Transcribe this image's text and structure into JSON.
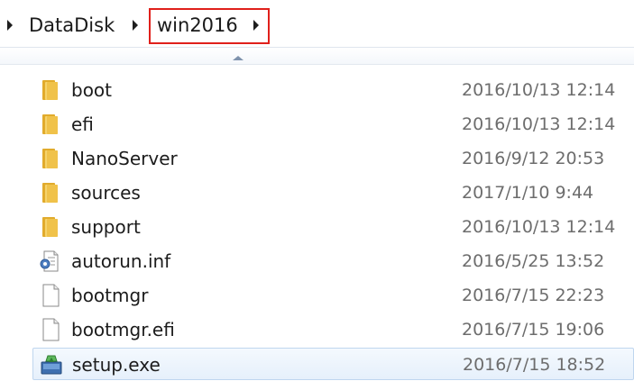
{
  "breadcrumb": {
    "segments": [
      {
        "label": "DataDisk"
      },
      {
        "label": "win2016"
      }
    ]
  },
  "file_list": {
    "sort_indicator": "ascending",
    "items": [
      {
        "name": "boot",
        "modified": "2016/10/13 12:14",
        "icon": "folder-icon"
      },
      {
        "name": "efi",
        "modified": "2016/10/13 12:14",
        "icon": "folder-icon"
      },
      {
        "name": "NanoServer",
        "modified": "2016/9/12 20:53",
        "icon": "folder-icon"
      },
      {
        "name": "sources",
        "modified": "2017/1/10 9:44",
        "icon": "folder-icon"
      },
      {
        "name": "support",
        "modified": "2016/10/13 12:14",
        "icon": "folder-icon"
      },
      {
        "name": "autorun.inf",
        "modified": "2016/5/25 13:52",
        "icon": "settings-file-icon"
      },
      {
        "name": "bootmgr",
        "modified": "2016/7/15 22:23",
        "icon": "blank-file-icon"
      },
      {
        "name": "bootmgr.efi",
        "modified": "2016/7/15 19:06",
        "icon": "blank-file-icon"
      },
      {
        "name": "setup.exe",
        "modified": "2016/7/15 18:52",
        "icon": "installer-icon",
        "selected": true
      }
    ]
  },
  "colors": {
    "highlight_box": "#e0201b",
    "selection": "#e6f0fb",
    "folder": "#f0c24a",
    "date_text": "#6d6d6d"
  }
}
